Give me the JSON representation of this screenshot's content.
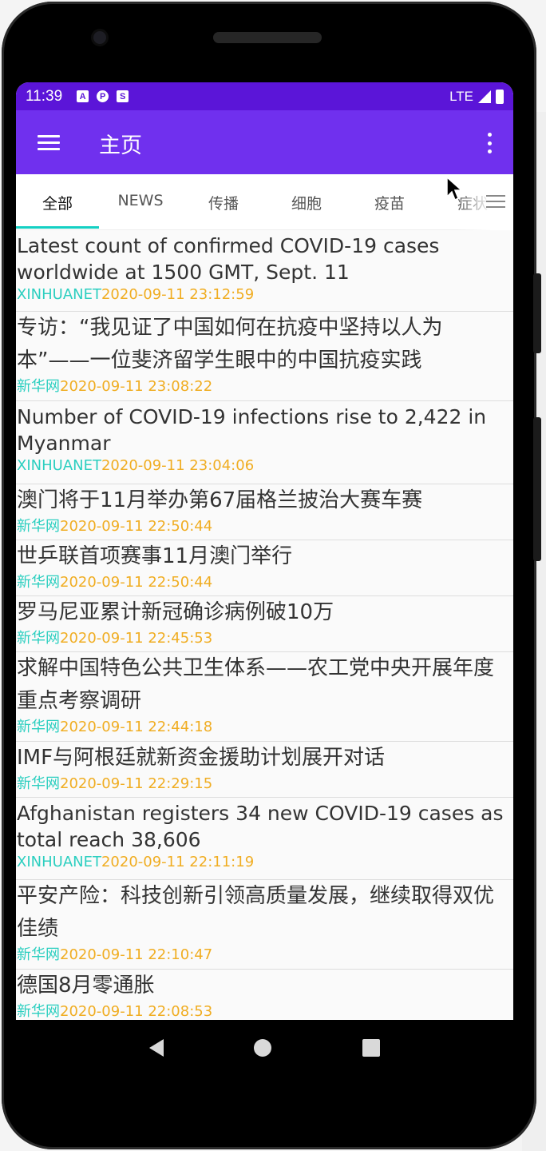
{
  "status_bar": {
    "time": "11:39",
    "icons": [
      "A",
      "P",
      "S"
    ],
    "network": "LTE"
  },
  "app_bar": {
    "title": "主页",
    "menu_icon": "hamburger-menu-icon",
    "overflow_icon": "more-vert-icon"
  },
  "tabs": [
    {
      "label": "全部",
      "active": true
    },
    {
      "label": "NEWS",
      "active": false
    },
    {
      "label": "传播",
      "active": false
    },
    {
      "label": "细胞",
      "active": false
    },
    {
      "label": "疫苗",
      "active": false
    },
    {
      "label": "症状",
      "active": false
    }
  ],
  "colors": {
    "status_bar": "#5b15d8",
    "app_bar": "#7030ee",
    "accent": "#14d0c3",
    "source": "#2ccfc0",
    "time": "#f0ad22"
  },
  "news": [
    {
      "title": "Latest count of confirmed COVID-19 cases worldwide at 1500 GMT, Sept. 11",
      "source": "XINHUANET",
      "time": "2020-09-11 23:12:59",
      "lang": "en"
    },
    {
      "title": "专访：“我见证了中国如何在抗疫中坚持以人为本”——一位斐济留学生眼中的中国抗疫实践",
      "source": "新华网",
      "time": "2020-09-11 23:08:22",
      "lang": "cn"
    },
    {
      "title": "Number of COVID-19 infections rise to 2,422 in Myanmar",
      "source": "XINHUANET",
      "time": "2020-09-11 23:04:06",
      "lang": "en"
    },
    {
      "title": "澳门将于11月举办第67届格兰披治大赛车赛",
      "source": "新华网",
      "time": "2020-09-11 22:50:44",
      "lang": "cn"
    },
    {
      "title": "世乒联首项赛事11月澳门举行",
      "source": "新华网",
      "time": "2020-09-11 22:50:44",
      "lang": "cn"
    },
    {
      "title": "罗马尼亚累计新冠确诊病例破10万",
      "source": "新华网",
      "time": "2020-09-11 22:45:53",
      "lang": "cn"
    },
    {
      "title": "求解中国特色公共卫生体系——农工党中央开展年度重点考察调研",
      "source": "新华网",
      "time": "2020-09-11 22:44:18",
      "lang": "cn"
    },
    {
      "title": "IMF与阿根廷就新资金援助计划展开对话",
      "source": "新华网",
      "time": "2020-09-11 22:29:15",
      "lang": "cn"
    },
    {
      "title": "Afghanistan registers 34 new COVID-19 cases as total reach 38,606",
      "source": "XINHUANET",
      "time": "2020-09-11 22:11:19",
      "lang": "en"
    },
    {
      "title": "平安产险：科技创新引领高质量发展，继续取得双优佳绩",
      "source": "新华网",
      "time": "2020-09-11 22:10:47",
      "lang": "cn"
    },
    {
      "title": "德国8月零通胀",
      "source": "新华网",
      "time": "2020-09-11 22:08:53",
      "lang": "cn"
    }
  ],
  "nav_bar": {
    "back_icon": "back-triangle-icon",
    "home_icon": "home-circle-icon",
    "recents_icon": "recents-square-icon"
  }
}
